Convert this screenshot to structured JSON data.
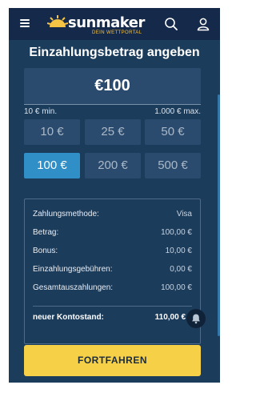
{
  "header": {
    "logo_word": "sunmaker",
    "logo_tagline": "DEIN WETTPORTAL",
    "menu_icon": "hamburger-menu-icon",
    "search_icon": "search-icon",
    "user_icon": "user-icon"
  },
  "deposit": {
    "title": "Einzahlungsbetrag angeben",
    "amount": "€100",
    "min_label": "10 € min.",
    "max_label": "1.000 € max.",
    "presets": [
      {
        "label": "10 €",
        "selected": false
      },
      {
        "label": "25 €",
        "selected": false
      },
      {
        "label": "50 €",
        "selected": false
      },
      {
        "label": "100 €",
        "selected": true
      },
      {
        "label": "200 €",
        "selected": false
      },
      {
        "label": "500 €",
        "selected": false
      }
    ]
  },
  "summary": {
    "rows": [
      {
        "label": "Zahlungsmethode:",
        "value": "Visa"
      },
      {
        "label": "Betrag:",
        "value": "100,00 €"
      },
      {
        "label": "Bonus:",
        "value": "10,00 €"
      },
      {
        "label": "Einzahlungsgebühren:",
        "value": "0,00 €"
      },
      {
        "label": "Gesamtauszahlungen:",
        "value": "100,00 €"
      }
    ],
    "total_label": "neuer Kontostand:",
    "total_value": "110,00 €"
  },
  "actions": {
    "continue_label": "FORTFAHREN",
    "bell_icon": "notification-bell-icon"
  },
  "colors": {
    "background": "#1c3c5c",
    "header": "#15294a",
    "accent_blue": "#2f8fc6",
    "button_yellow": "#f6d147"
  }
}
